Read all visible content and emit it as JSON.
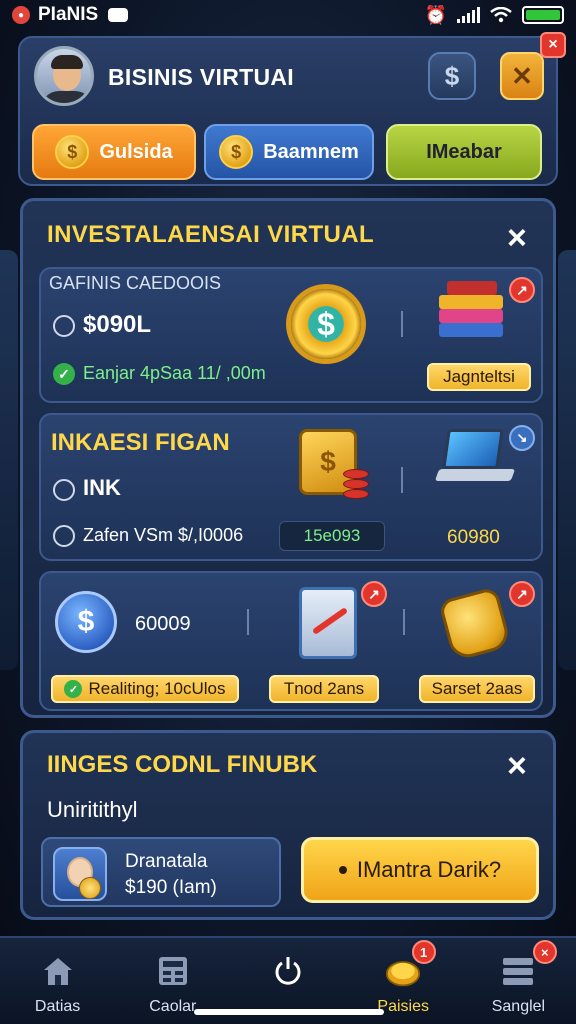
{
  "status_bar": {
    "app_name": "PIaNIS"
  },
  "header": {
    "title": "BISINIS VIRTUAI",
    "coin_button": "$",
    "close": "×",
    "tabs": [
      {
        "label": "Gulsida",
        "color": "#f08a1f"
      },
      {
        "label": "Baamnem",
        "color": "#3568bd"
      },
      {
        "label": "IMeabar",
        "color": "#a4c233"
      }
    ]
  },
  "invest_panel": {
    "title": "INVESTALAENSAI VIRTUAL",
    "close": "×",
    "card1": {
      "label": "GAFINIS CAEDOOIS",
      "amount": "$090L",
      "earn": "Eanjar 4pSaa 11/ ,00m",
      "action": "Jagnteltsi",
      "badge": "↗"
    },
    "card2": {
      "label": "INKAESI FIGAN",
      "sub": "INK",
      "earn": "Zafen VSm $/,I0006",
      "value_box": "15e093",
      "value_right": "60980",
      "badge": "↘"
    },
    "card3": {
      "amount": "60009",
      "status": "Realiting; 10cUlos",
      "action_mid": "Tnod 2ans",
      "action_right": "Sarset 2aas"
    }
  },
  "offer_panel": {
    "title": "IINGES CODNL FINUBK",
    "subtitle": "Uniritithyl",
    "close": "×",
    "item_name": "Dranatala",
    "item_price": "$190 (Iam)",
    "cta": "IMantra Darik?"
  },
  "nav": {
    "items": [
      {
        "label": "Datias",
        "icon": "home-icon"
      },
      {
        "label": "Caolar",
        "icon": "calculator-icon"
      },
      {
        "label": "",
        "icon": "power-icon"
      },
      {
        "label": "Paisies",
        "icon": "coins-icon",
        "badge": "1"
      },
      {
        "label": "Sanglel",
        "icon": "server-icon",
        "badge": "×"
      }
    ]
  },
  "colors": {
    "accent_gold": "#ffd84a",
    "accent_green": "#7df08a",
    "panel": "#213456",
    "border": "#3d5a8e"
  }
}
